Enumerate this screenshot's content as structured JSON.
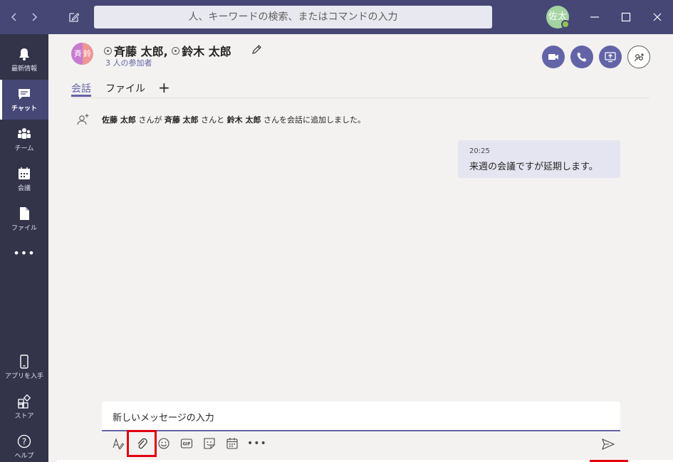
{
  "titlebar": {
    "search_placeholder": "人、キーワードの検索、またはコマンドの入力",
    "user_avatar_initials": "佐太",
    "user_status_color": "#92c353"
  },
  "rail": {
    "items": [
      {
        "label": "最新情報",
        "icon": "bell-icon"
      },
      {
        "label": "チャット",
        "icon": "chat-icon",
        "active": true
      },
      {
        "label": "チーム",
        "icon": "teams-icon"
      },
      {
        "label": "会議",
        "icon": "calendar-icon"
      },
      {
        "label": "ファイル",
        "icon": "file-icon"
      }
    ],
    "more_label": "•••",
    "bottom_items": [
      {
        "label": "アプリを入手",
        "icon": "mobile-icon"
      },
      {
        "label": "ストア",
        "icon": "store-icon"
      },
      {
        "label": "ヘルプ",
        "icon": "help-icon"
      }
    ]
  },
  "header": {
    "avatar_left": "斉",
    "avatar_right": "鈴",
    "name1": "斉藤 太郎",
    "separator": ",",
    "name2": "鈴木 太郎",
    "participants": "3 人の参加者"
  },
  "tabs": [
    {
      "label": "会話",
      "active": true
    },
    {
      "label": "ファイル"
    }
  ],
  "tab_add": "+",
  "system_message": {
    "actor": "佐藤 太郎",
    "part1": " さんが ",
    "person1": "斉藤 太郎",
    "part2": " さんと ",
    "person2": "鈴木 太郎",
    "part3": " さんを会話に追加しました。"
  },
  "message": {
    "time": "20:25",
    "text": "来週の会議ですが延期します。"
  },
  "compose": {
    "placeholder": "新しいメッセージの入力",
    "more_label": "•••"
  },
  "colors": {
    "accent": "#6264a7",
    "titlebar": "#464775",
    "rail": "#33344a",
    "highlight": "#e3000f"
  }
}
